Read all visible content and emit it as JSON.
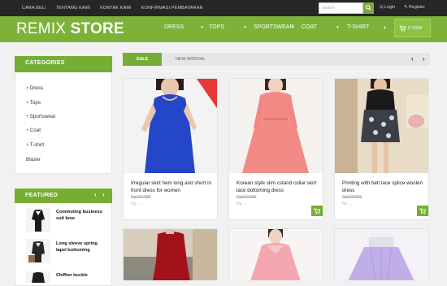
{
  "topbar": {
    "nav": [
      "CARA BELI",
      "TENTANG KAMI",
      "KONTAK KAMI",
      "KONFIRMASI PEMBAYARAN"
    ],
    "search_placeholder": "Search",
    "search_icon": "search-icon",
    "login": "Login",
    "register": "Register"
  },
  "header": {
    "logo_light": "REMIX",
    "logo_bold": "STORE",
    "menu": [
      "DRESS",
      "TOPS",
      "SPORTSWEAR",
      "COAT",
      "T-SHIRT"
    ],
    "cart_label": "0 ITEM",
    "accent": "#7cb237"
  },
  "categories": {
    "title": "CATEGORIES",
    "items": [
      "Dress",
      "Tops",
      "Sportswear",
      "Coat",
      "T-shirt",
      "Blazer"
    ]
  },
  "featured": {
    "title": "FEATURED",
    "items": [
      {
        "name": "Commuting business suit bow"
      },
      {
        "name": "Long sleeve spring lapel bottoming"
      },
      {
        "name": "Chiffon buckle"
      }
    ]
  },
  "tabs": {
    "sale": "SALE",
    "new_arrival": "NEW ARRIVAL"
  },
  "products": [
    {
      "title": "Irregular skirt hem long and short in front dress for women",
      "old_price": "Rp100.000",
      "price": "Rp ..."
    },
    {
      "title": "Korean style slim cstand collar skirt lace bottoming dress",
      "old_price": "Rp100.000",
      "price": "Rp ..."
    },
    {
      "title": "Printing with belt lace splice woolen dress",
      "old_price": "Rp100.000",
      "price": "Rp ..."
    }
  ]
}
